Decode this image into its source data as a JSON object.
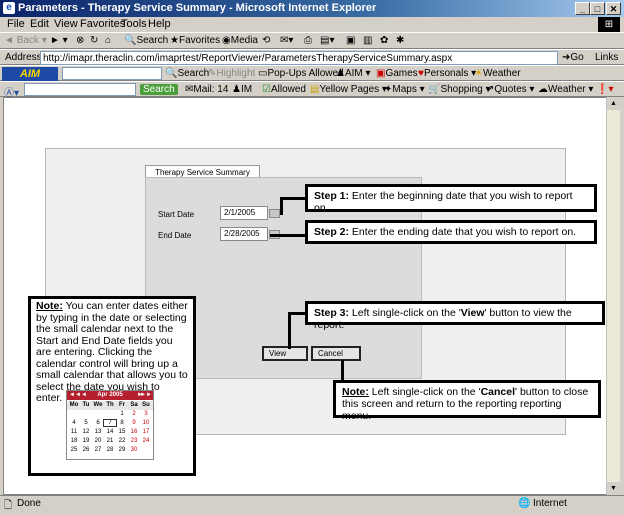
{
  "window": {
    "title": "Parameters - Therapy Service Summary - Microsoft Internet Explorer"
  },
  "menu": [
    "File",
    "Edit",
    "View",
    "Favorites",
    "Tools",
    "Help"
  ],
  "toolbar": {
    "back": "Back",
    "search": "Search",
    "favorites": "Favorites",
    "media": "Media"
  },
  "address": {
    "label": "Address",
    "url": "http://imapr.theraclin.com/imaprtest/ReportViewer/ParametersTherapyServiceSummary.aspx",
    "go": "Go",
    "links": "Links"
  },
  "aimbar": {
    "logo": "AIM",
    "search": "Search",
    "highlight": "Highlight",
    "popups": "Pop-Ups Allowed",
    "aim": "AIM",
    "games": "Games",
    "personals": "Personals",
    "weather": "Weather"
  },
  "searchbar": {
    "search_btn": "Search",
    "mail": "Mail: 14",
    "im": "IM",
    "allowed": "Allowed",
    "yellow": "Yellow Pages",
    "maps": "Maps",
    "shopping": "Shopping",
    "quotes": "Quotes",
    "weather": "Weather"
  },
  "status": {
    "left": "Done",
    "zone": "Internet"
  },
  "report": {
    "tab": "Therapy Service Summary",
    "start_label": "Start Date",
    "start_value": "2/1/2005",
    "end_label": "End Date",
    "end_value": "2/28/2005",
    "view_btn": "View",
    "cancel_btn": "Cancel"
  },
  "callouts": {
    "step1_head": "Step 1:",
    "step1_text": " Enter the beginning date that you wish to report on.",
    "step2_head": "Step 2:",
    "step2_text": " Enter the ending date that you wish to report on.",
    "step3_head": "Step 3:",
    "step3_text_a": " Left single-click on the '",
    "step3_bold": "View",
    "step3_text_b": "' button to view the report.",
    "note2_head": "Note:",
    "note2_text_a": " Left single-click on the '",
    "note2_bold": "Cancel",
    "note2_text_b": "' button to close this screen and return to the reporting reporting menu.",
    "note1_head": "Note:",
    "note1_text": " You can enter dates either by typing in the date or selecting the small calendar next to the Start and End Date fields you are entering. Clicking the calendar control will bring up a small calendar that allows you to select the date you wish to enter."
  },
  "calendar": {
    "month": "Apr 2005",
    "days": [
      "Mo",
      "Tu",
      "We",
      "Th",
      "Fr",
      "Sa",
      "Su"
    ],
    "rows": [
      [
        "",
        "",
        "",
        "",
        "1",
        "2",
        "3"
      ],
      [
        "4",
        "5",
        "6",
        "7",
        "8",
        "9",
        "10"
      ],
      [
        "11",
        "12",
        "13",
        "14",
        "15",
        "16",
        "17"
      ],
      [
        "18",
        "19",
        "20",
        "21",
        "22",
        "23",
        "24"
      ],
      [
        "25",
        "26",
        "27",
        "28",
        "29",
        "30",
        ""
      ]
    ]
  }
}
